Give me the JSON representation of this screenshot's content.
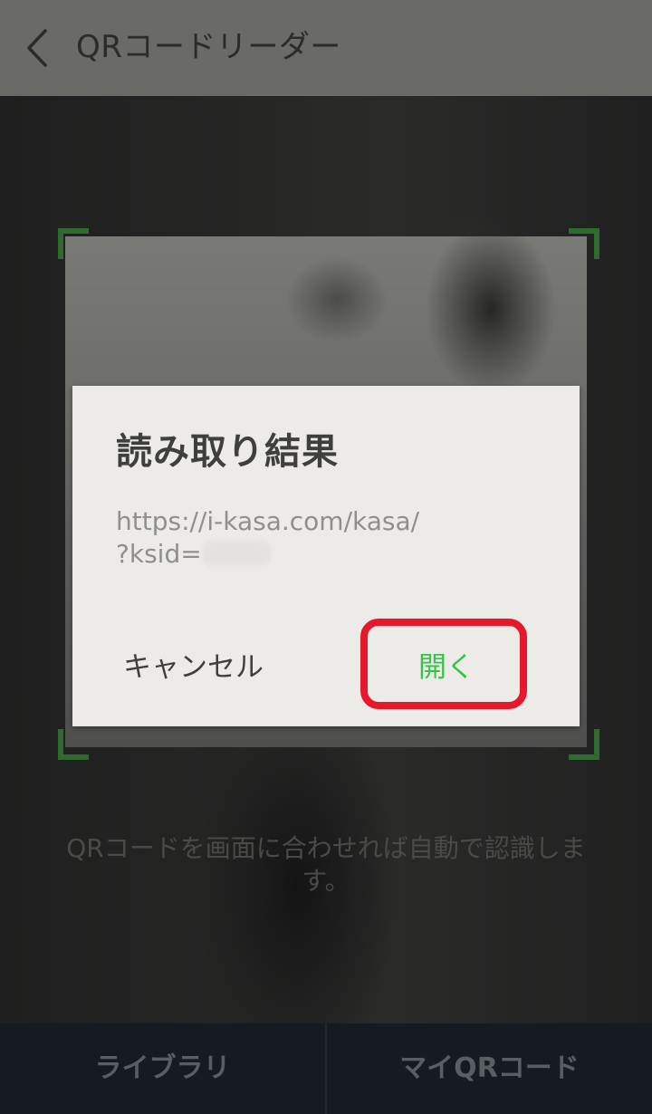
{
  "header": {
    "title": "QRコードリーダー",
    "back_icon": "chevron-left-icon"
  },
  "scanner": {
    "instruction": "QRコードを画面に合わせれば自動で認識します。",
    "frame_color": "#2f6a2e"
  },
  "dialog": {
    "title": "読み取り結果",
    "url_line1": "https://i-kasa.com/kasa/",
    "url_line2": "?ksid=",
    "cancel_label": "キャンセル",
    "open_label": "開く",
    "open_color": "#33c548"
  },
  "annotation": {
    "highlight_color": "#e8182c"
  },
  "bottom_tabs": [
    {
      "label": "ライブラリ"
    },
    {
      "label": "マイQRコード"
    }
  ]
}
